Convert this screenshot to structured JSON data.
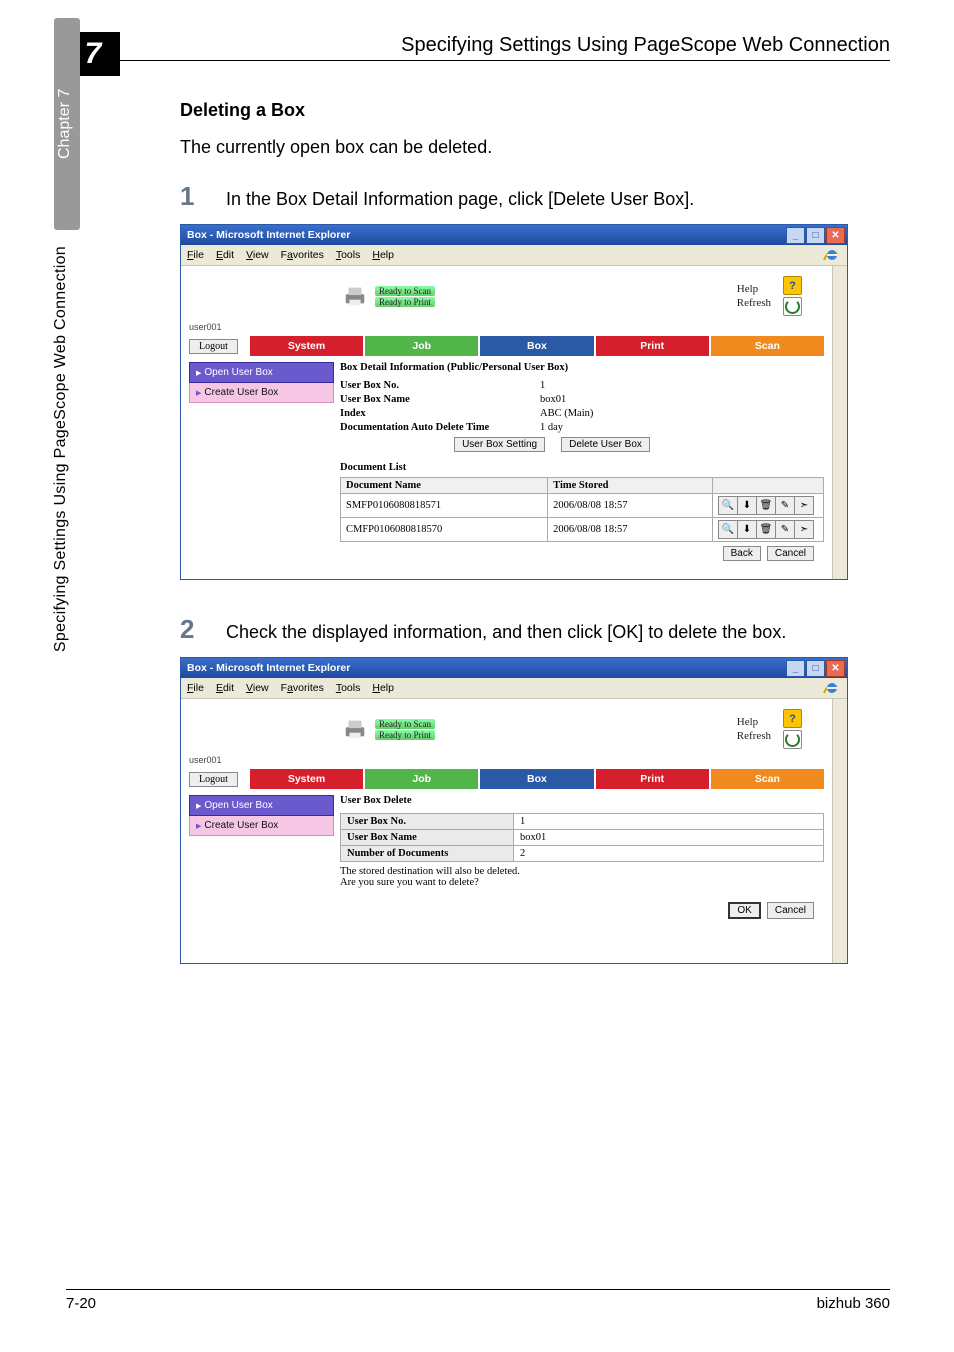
{
  "page": {
    "chapter_num": "7",
    "header_title": "Specifying Settings Using PageScope Web Connection",
    "side_chapter": "Chapter 7",
    "side_long": "Specifying Settings Using PageScope Web Connection",
    "footer_page": "7-20",
    "footer_model": "bizhub 360"
  },
  "heading": "Deleting a Box",
  "intro": "The currently open box can be deleted.",
  "step1_num": "1",
  "step1_text": "In the Box Detail Information page, click [Delete User Box].",
  "step2_num": "2",
  "step2_text": "Check the displayed information, and then click [OK] to delete the box.",
  "ie": {
    "title": "Box - Microsoft Internet Explorer",
    "menu": {
      "file": "File",
      "edit": "Edit",
      "view": "View",
      "favorites": "Favorites",
      "tools": "Tools",
      "help": "Help"
    }
  },
  "status": {
    "ready_scan": "Ready to Scan",
    "ready_print": "Ready to Print",
    "help": "Help",
    "refresh": "Refresh",
    "userid": "user001",
    "logout": "Logout"
  },
  "tabs": {
    "system": "System",
    "job": "Job",
    "box": "Box",
    "print": "Print",
    "scan": "Scan"
  },
  "side": {
    "open": "Open User Box",
    "create": "Create User Box"
  },
  "shot1": {
    "title": "Box Detail Information (Public/Personal User Box)",
    "k_no": "User Box No.",
    "v_no": "1",
    "k_name": "User Box Name",
    "v_name": "box01",
    "k_index": "Index",
    "v_index": "ABC  (Main)",
    "k_del": "Documentation Auto Delete Time",
    "v_del": "1 day",
    "btn_setting": "User Box Setting",
    "btn_delete": "Delete User Box",
    "doclist": "Document List",
    "th_name": "Document Name",
    "th_time": "Time Stored",
    "rows": [
      {
        "name": "SMFP0106080818571",
        "time": "2006/08/08  18:57"
      },
      {
        "name": "CMFP0106080818570",
        "time": "2006/08/08  18:57"
      }
    ],
    "back": "Back",
    "cancel": "Cancel"
  },
  "shot2": {
    "title": "User Box Delete",
    "k_no": "User Box No.",
    "v_no": "1",
    "k_name": "User Box Name",
    "v_name": "box01",
    "k_num": "Number of Documents",
    "v_num": "2",
    "msg1": "The stored destination will also be deleted.",
    "msg2": "Are you sure you want to delete?",
    "ok": "OK",
    "cancel": "Cancel"
  }
}
